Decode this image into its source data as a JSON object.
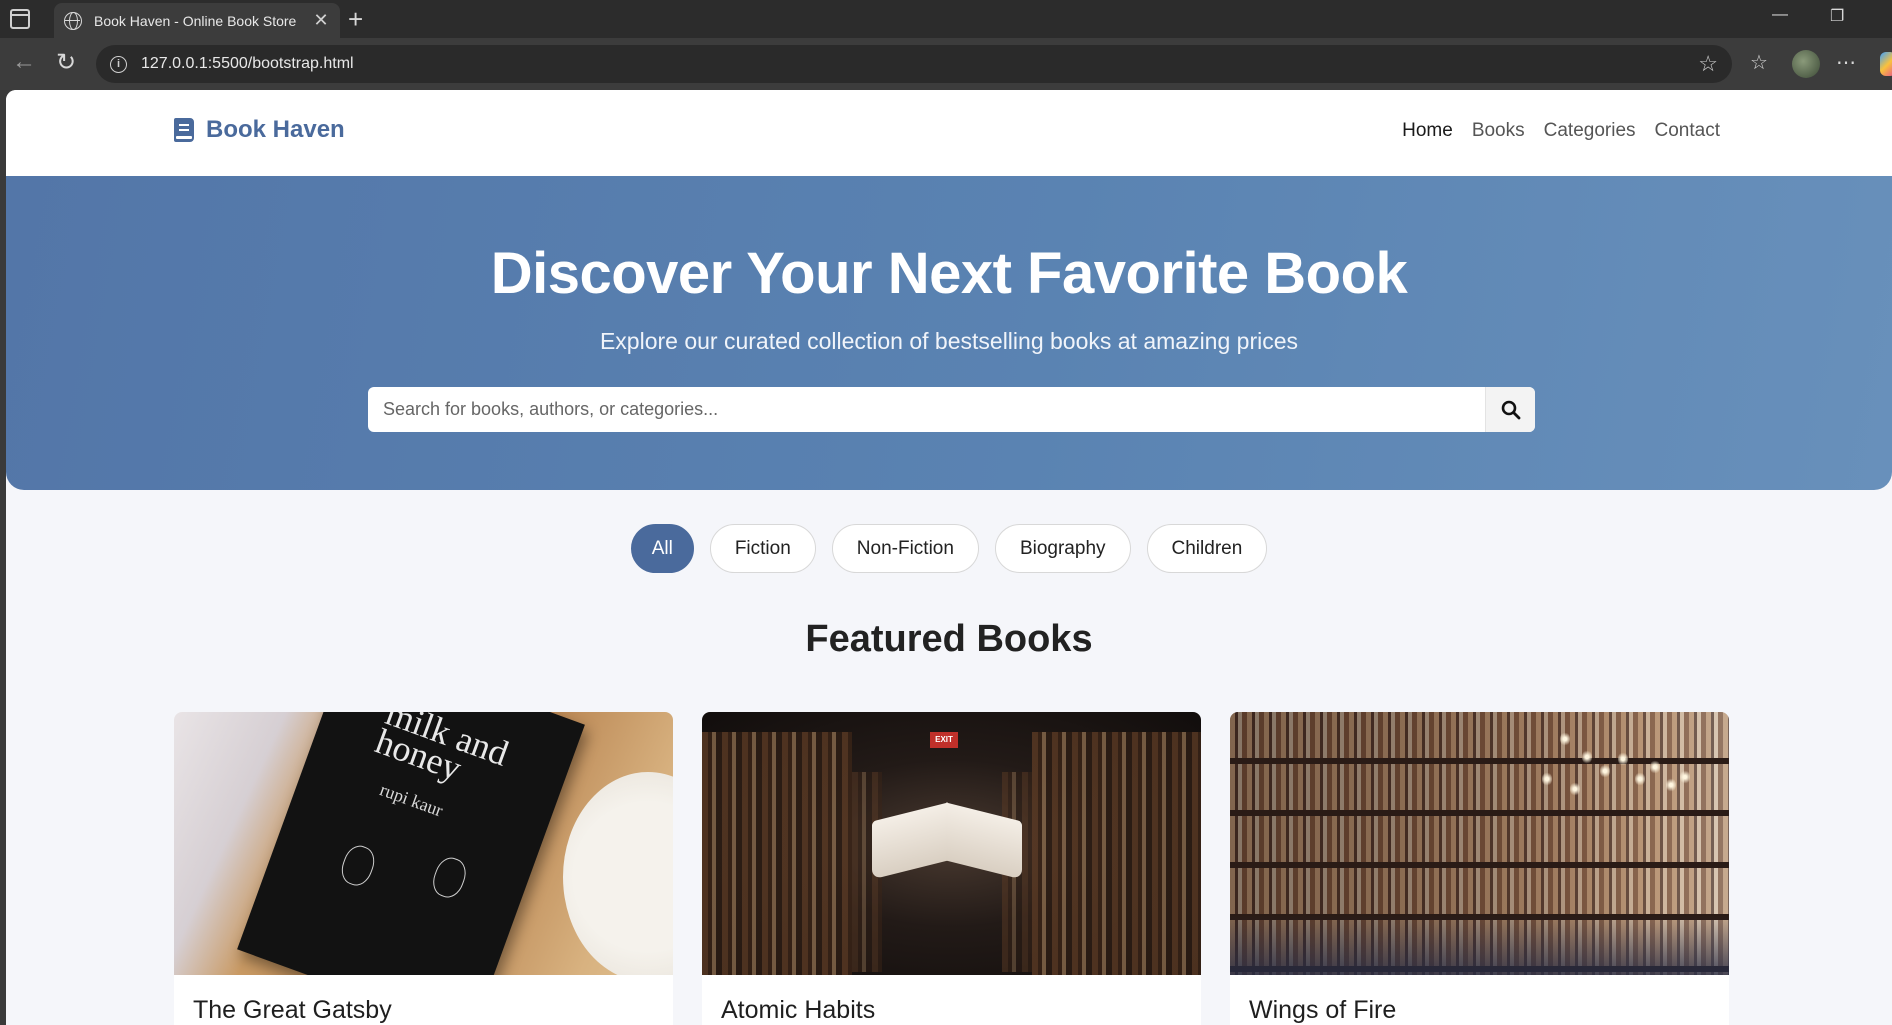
{
  "browser": {
    "tab_title": "Book Haven - Online Book Store",
    "url": "127.0.0.1:5500/bootstrap.html"
  },
  "site": {
    "brand": "Book Haven",
    "nav": [
      "Home",
      "Books",
      "Categories",
      "Contact"
    ],
    "active_nav": "Home",
    "accent_color": "#4a6a9c"
  },
  "hero": {
    "title": "Discover Your Next Favorite Book",
    "subtitle": "Explore our curated collection of bestselling books at amazing prices",
    "search_placeholder": "Search for books, authors, or categories..."
  },
  "filters": {
    "items": [
      "All",
      "Fiction",
      "Non-Fiction",
      "Biography",
      "Children"
    ],
    "active": "All"
  },
  "featured": {
    "heading": "Featured Books",
    "books": [
      {
        "title": "The Great Gatsby",
        "cover_text": "milk and honey",
        "cover_author": "rupi kaur"
      },
      {
        "title": "Atomic Habits",
        "sign_text": "EXIT"
      },
      {
        "title": "Wings of Fire"
      }
    ]
  }
}
